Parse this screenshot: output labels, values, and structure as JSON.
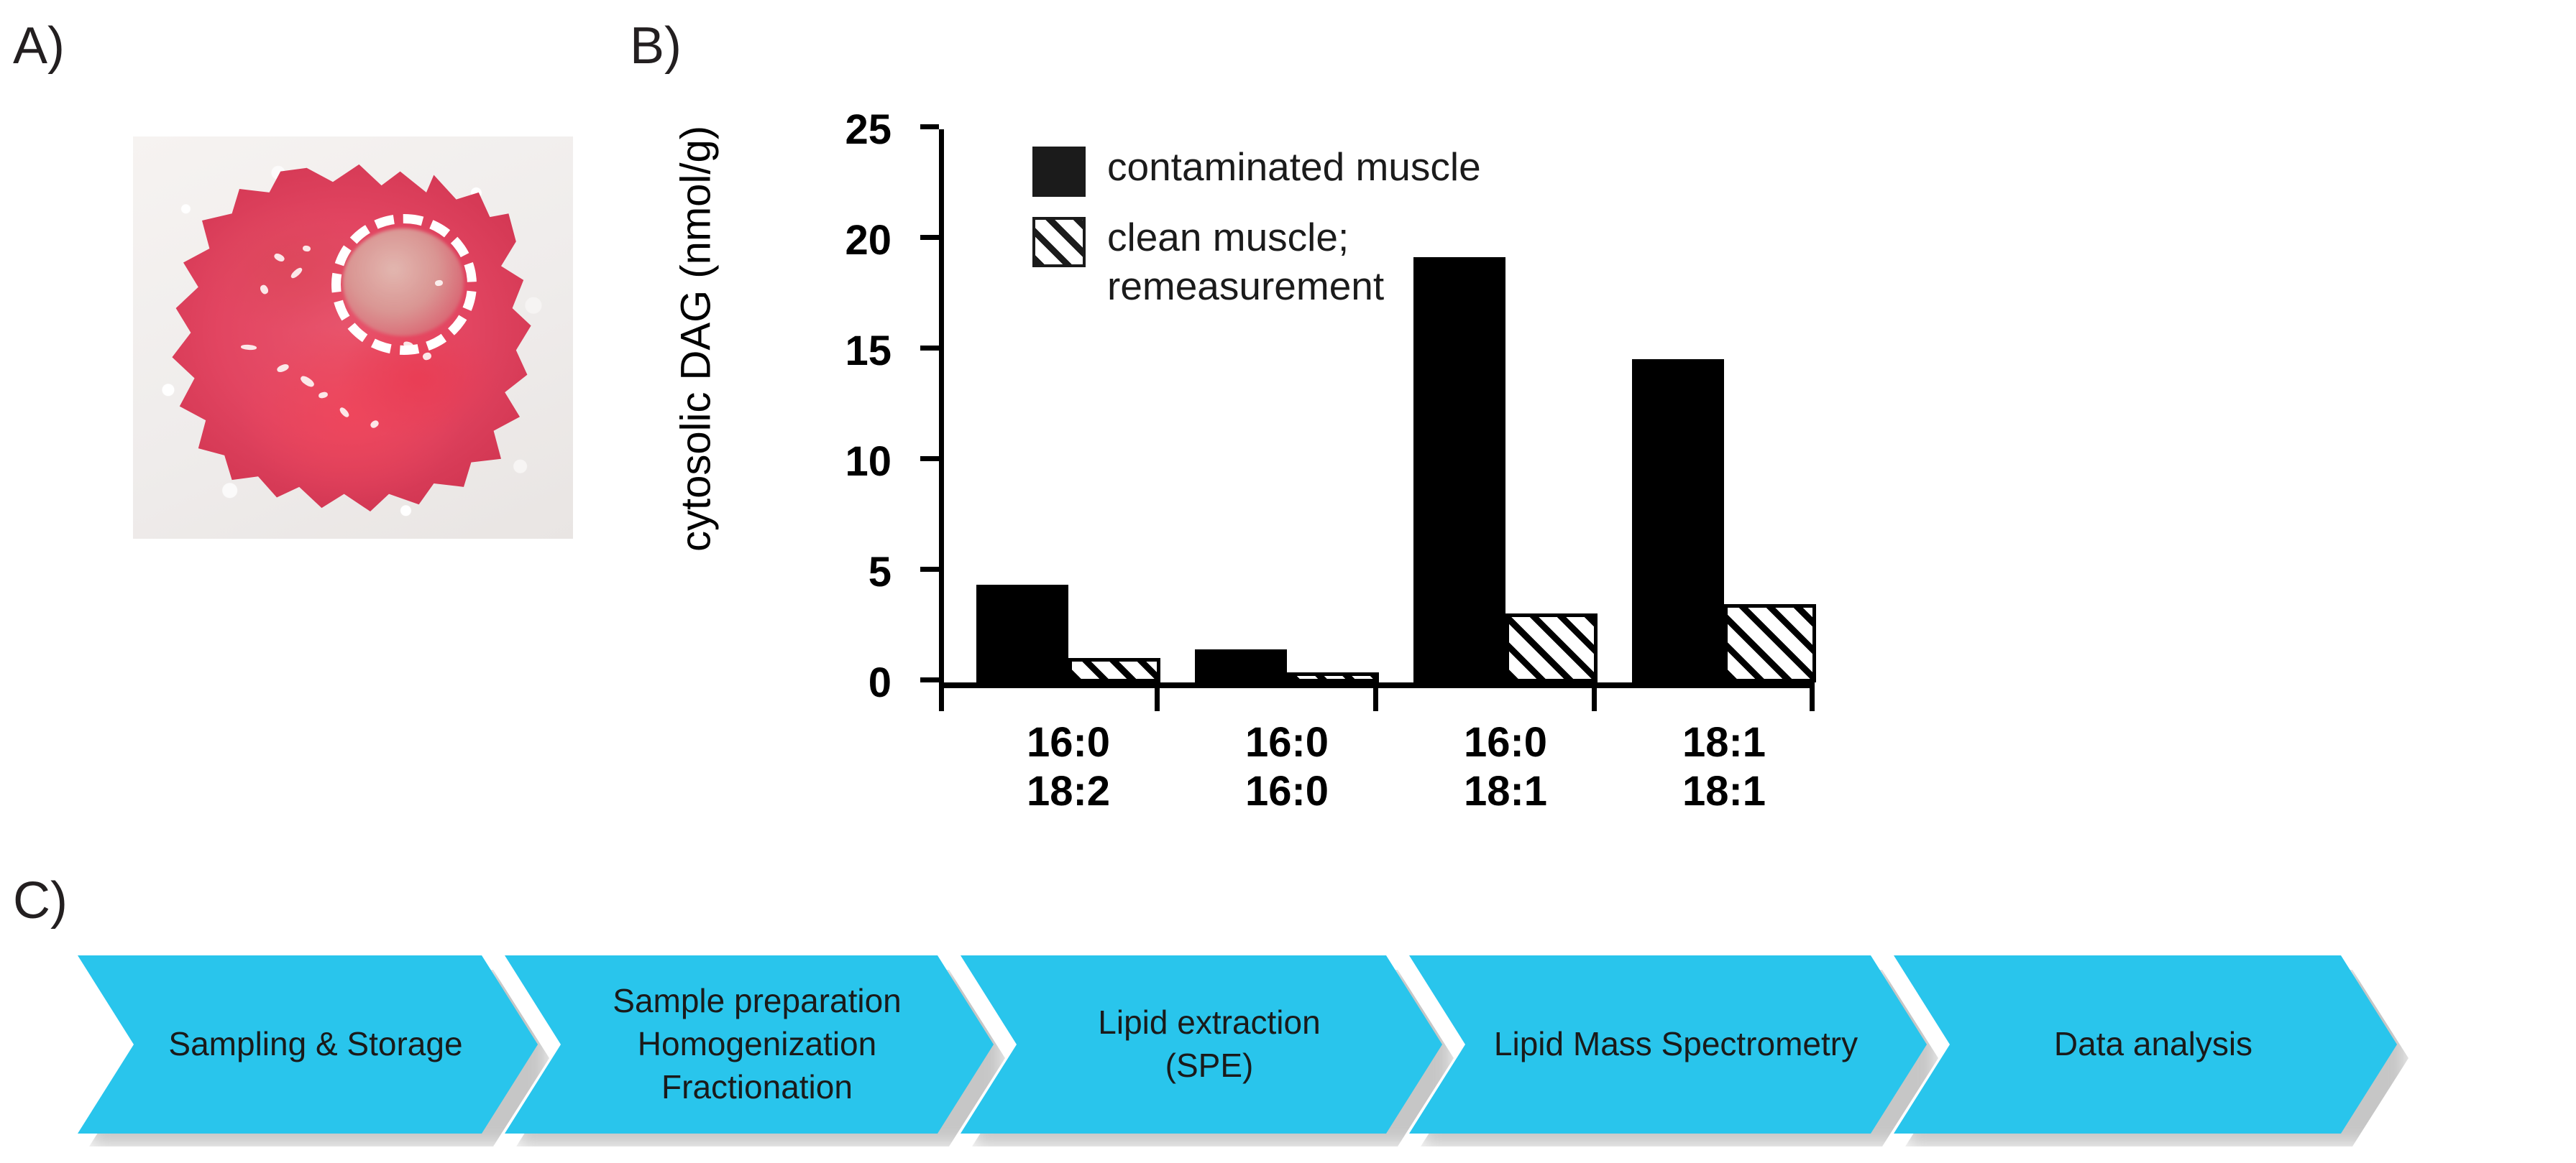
{
  "panels": {
    "a": {
      "letter": "A)",
      "caption_roi": "dashed-circle-region-of-interest"
    },
    "b": {
      "letter": "B)"
    },
    "c": {
      "letter": "C)"
    }
  },
  "chart_data": {
    "type": "bar",
    "title": "",
    "xlabel": "",
    "ylabel": "cytosolic DAG (nmol/g)",
    "ylim": [
      0,
      25
    ],
    "yticks": [
      0,
      5,
      10,
      15,
      20,
      25
    ],
    "ytick_labels": [
      "0",
      "5",
      "10",
      "15",
      "20",
      "25"
    ],
    "grid": false,
    "legend_position": "top-left-inside",
    "categories": [
      "16:0\n18:2",
      "16:0\n16:0",
      "16:0\n18:1",
      "18:1\n18:1"
    ],
    "category_lines": [
      [
        "16:0",
        "18:2"
      ],
      [
        "16:0",
        "16:0"
      ],
      [
        "16:0",
        "18:1"
      ],
      [
        "18:1",
        "18:1"
      ]
    ],
    "series": [
      {
        "name": "contaminated muscle",
        "fill": "solid",
        "color": "#000000",
        "values": [
          4.4,
          1.5,
          19.2,
          14.6
        ]
      },
      {
        "name": "clean muscle;\nremeasurement",
        "fill": "hatched",
        "color": "#000000",
        "values": [
          1.1,
          0.4,
          3.1,
          3.5
        ]
      }
    ]
  },
  "legend": {
    "items": [
      {
        "label": "contaminated muscle",
        "swatch": "solid-black-square"
      },
      {
        "label": "clean muscle;\nremeasurement",
        "swatch": "hatched-square"
      }
    ]
  },
  "workflow": {
    "accent_color": "#29c5ec",
    "steps": [
      {
        "label": "Sampling & Storage"
      },
      {
        "label": "Sample preparation\nHomogenization\nFractionation"
      },
      {
        "label": "Lipid extraction\n(SPE)"
      },
      {
        "label": "Lipid Mass Spectrometry"
      },
      {
        "label": "Data analysis"
      }
    ]
  }
}
